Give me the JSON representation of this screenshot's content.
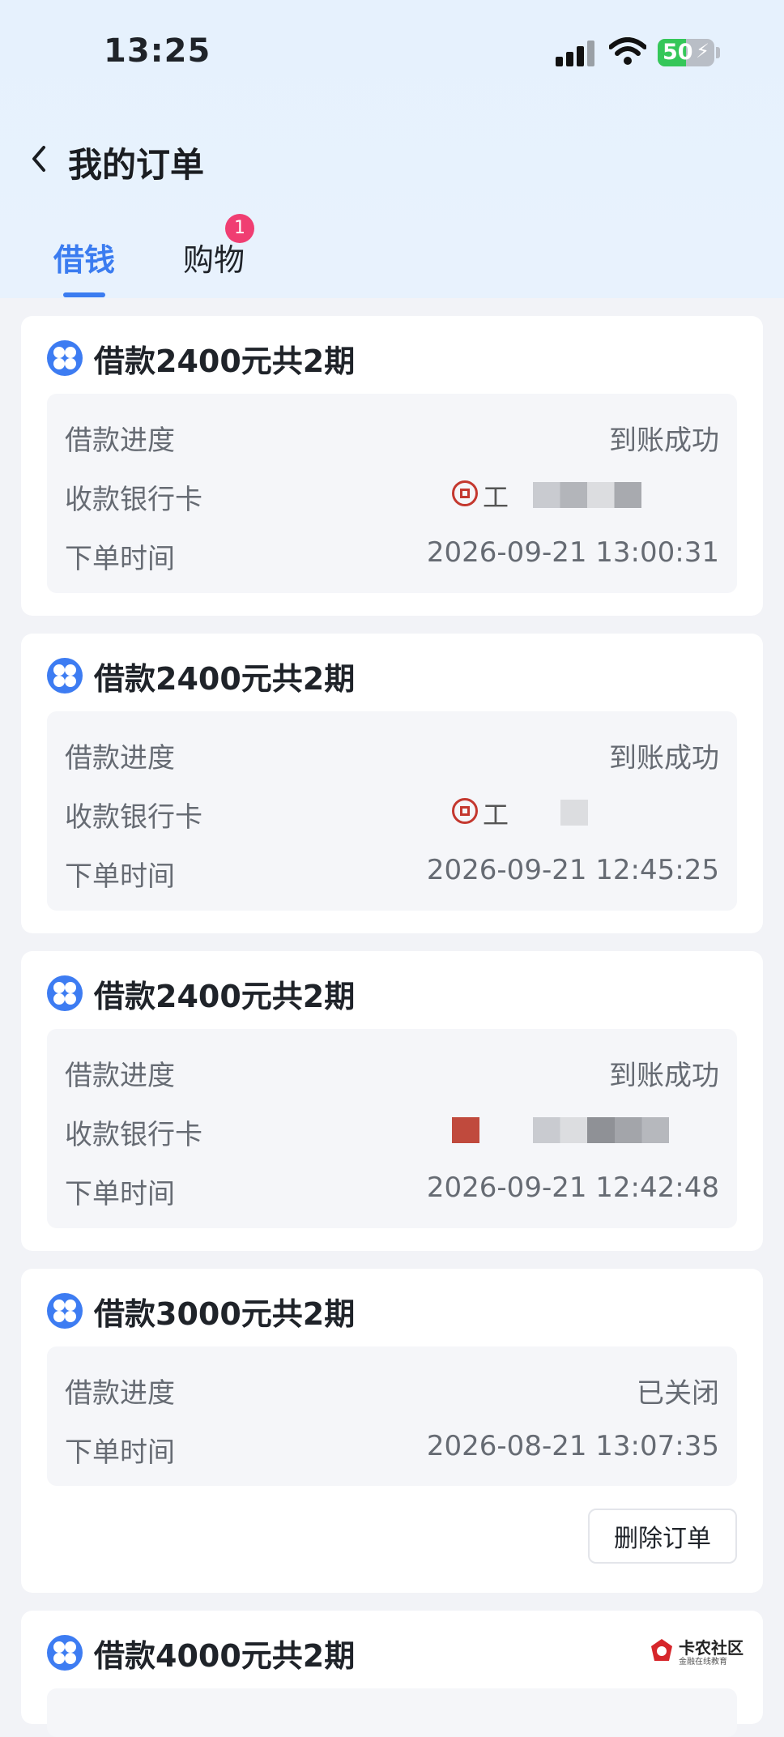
{
  "status_bar": {
    "time": "13:25",
    "battery": "50",
    "battery_level": 0.5
  },
  "nav": {
    "title": "我的订单"
  },
  "tabs": [
    {
      "label": "借钱"
    },
    {
      "label": "购物",
      "badge": "1"
    }
  ],
  "labels": {
    "progress": "借款进度",
    "bank_card": "收款银行卡",
    "order_time": "下单时间"
  },
  "orders": [
    {
      "title": "借款2400元共2期",
      "progress": "到账成功",
      "bank": "工",
      "time": "2026-09-21 13:00:31"
    },
    {
      "title": "借款2400元共2期",
      "progress": "到账成功",
      "bank": "工",
      "time": "2026-09-21 12:45:25"
    },
    {
      "title": "借款2400元共2期",
      "progress": "到账成功",
      "time": "2026-09-21 12:42:48"
    },
    {
      "title": "借款3000元共2期",
      "progress": "已关闭",
      "time": "2026-08-21 13:07:35",
      "action": "删除订单"
    },
    {
      "title": "借款4000元共2期"
    }
  ],
  "watermark": {
    "name": "卡农社区",
    "tagline": "金融在线教育"
  },
  "colors": {
    "accent": "#3b7cf0",
    "badge": "#f03e72",
    "bank_icon": "#c4382f"
  }
}
